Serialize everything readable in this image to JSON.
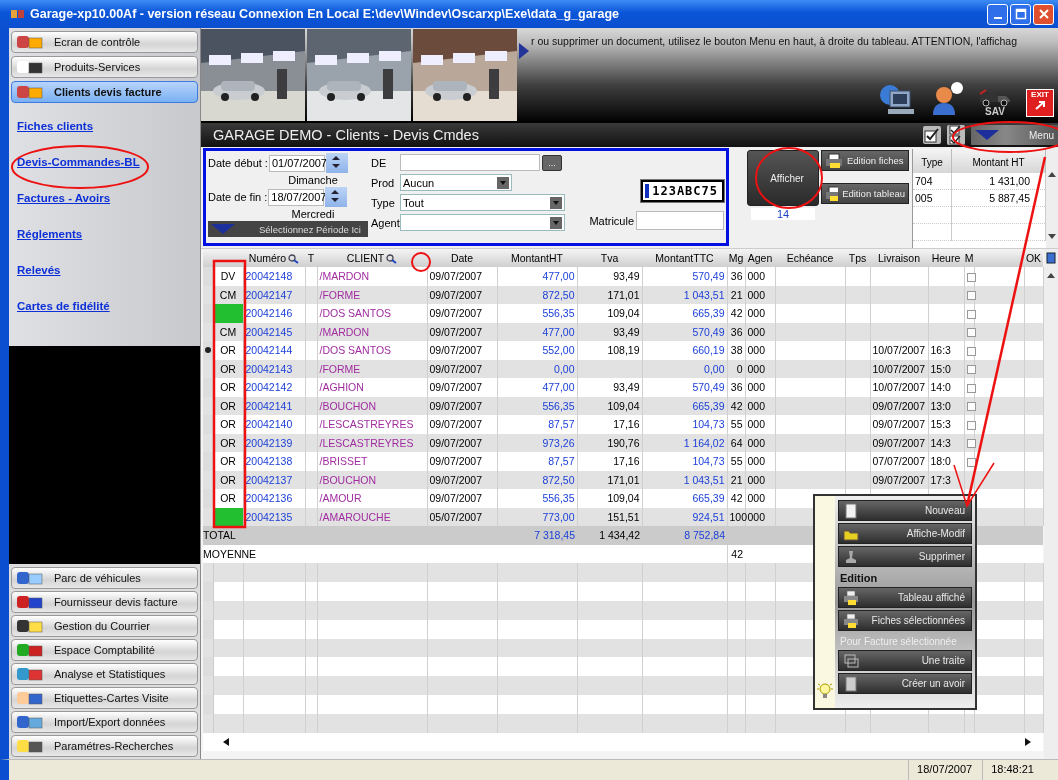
{
  "window": {
    "title": "Garage-xp10.00Af - version réseau Connexion En Local E:\\dev\\Windev\\Oscarxp\\Exe\\data_g_garage"
  },
  "sidebar": {
    "top_modules": [
      {
        "label": "Ecran de contrôle",
        "selected": false
      },
      {
        "label": "Produits-Services",
        "selected": false
      },
      {
        "label": "Clients devis facture",
        "selected": true
      }
    ],
    "links": [
      "Fiches clients",
      "Devis-Commandes-BL",
      "Factures - Avoirs",
      "Réglements",
      "Relevés",
      "Cartes de fidélité"
    ],
    "bottom_modules": [
      {
        "label": "Parc de véhicules",
        "selected": false
      },
      {
        "label": "Fournisseur devis facture",
        "selected": false
      },
      {
        "label": "Gestion du Courrier",
        "selected": false
      },
      {
        "label": "Espace Comptabilité",
        "selected": false
      },
      {
        "label": "Analyse et Statistiques",
        "selected": false
      },
      {
        "label": "Etiquettes-Cartes Visite",
        "selected": false
      },
      {
        "label": "Import/Export données",
        "selected": false
      },
      {
        "label": "Paramétres-Recherches",
        "selected": false
      }
    ]
  },
  "banner": {
    "ticker": "r ou supprimer un document, utilisez le bouton Menu en haut, à droite du tableau.  ATTENTION, l'affichag",
    "sav_label": "SAV",
    "exit_label": "EXIT"
  },
  "panel": {
    "title": "GARAGE DEMO - Clients - Devis Cmdes",
    "menu_button": "Menu"
  },
  "filters": {
    "start_label": "Date début :",
    "start_date": "01/07/2007",
    "start_day": "Dimanche",
    "end_label": "Date de fin :",
    "end_date": "18/07/2007",
    "end_day": "Mercredi",
    "period_button": "Sélectionnez Période Ici",
    "de_label": "DE",
    "de_button": "...",
    "prod_label": "Prod",
    "prod_value": "Aucun",
    "type_label": "Type",
    "type_value": "Tout",
    "agent_label": "Agent",
    "plate": "123ABC75",
    "matricule_label": "Matricule"
  },
  "actions": {
    "show_button": "Afficher",
    "count": "14",
    "edit_cards_button": "Edition fiches",
    "edit_table_button": "Edition tableau"
  },
  "summary": {
    "columns": [
      "Type",
      "Montant HT"
    ],
    "rows": [
      [
        "704",
        "1 431,00"
      ],
      [
        "005",
        "5 887,45"
      ]
    ]
  },
  "table": {
    "columns": [
      "",
      "",
      "Numéro",
      "T",
      "CLIENT",
      "Date",
      "MontantHT",
      "Tva",
      "MontantTTC",
      "Mg",
      "Agen",
      "Echéance",
      "Tps",
      "Livraison",
      "Heure",
      "M",
      "",
      "OK"
    ],
    "rows": [
      {
        "code": "DV",
        "number": "20042148",
        "client": "/MARDON",
        "date": "09/07/2007",
        "ht": "477,00",
        "tva": "93,49",
        "ttc": "570,49",
        "mg": "36",
        "agen": "000",
        "highlighted": false,
        "selected": false,
        "checked": false
      },
      {
        "code": "CM",
        "number": "20042147",
        "client": "/FORME",
        "date": "09/07/2007",
        "ht": "872,50",
        "tva": "171,01",
        "ttc": "1 043,51",
        "mg": "21",
        "agen": "000",
        "highlighted": false,
        "selected": false,
        "checked": false
      },
      {
        "number": "20042146",
        "client": "/DOS SANTOS",
        "date": "09/07/2007",
        "ht": "556,35",
        "tva": "109,04",
        "ttc": "665,39",
        "mg": "42",
        "agen": "000",
        "highlighted": true,
        "selected": false,
        "checked": false
      },
      {
        "code": "CM",
        "number": "20042145",
        "client": "/MARDON",
        "date": "09/07/2007",
        "ht": "477,00",
        "tva": "93,49",
        "ttc": "570,49",
        "mg": "36",
        "agen": "000",
        "highlighted": false,
        "selected": false,
        "checked": false
      },
      {
        "code": "OR",
        "number": "20042144",
        "client": "/DOS SANTOS",
        "date": "09/07/2007",
        "ht": "552,00",
        "tva": "108,19",
        "ttc": "660,19",
        "mg": "38",
        "agen": "000",
        "delivery": "10/07/2007",
        "hour": "16:3",
        "highlighted": false,
        "selected": true,
        "checked": false
      },
      {
        "code": "OR",
        "number": "20042143",
        "client": "/FORME",
        "date": "09/07/2007",
        "ht": "0,00",
        "ttc": "0,00",
        "mg": "0",
        "agen": "000",
        "delivery": "10/07/2007",
        "hour": "15:0",
        "highlighted": false,
        "selected": false,
        "checked": false
      },
      {
        "code": "OR",
        "number": "20042142",
        "client": "/AGHION",
        "date": "09/07/2007",
        "ht": "477,00",
        "tva": "93,49",
        "ttc": "570,49",
        "mg": "36",
        "agen": "000",
        "delivery": "10/07/2007",
        "hour": "14:0",
        "highlighted": false,
        "selected": false,
        "checked": false
      },
      {
        "code": "OR",
        "number": "20042141",
        "client": "/BOUCHON",
        "date": "09/07/2007",
        "ht": "556,35",
        "tva": "109,04",
        "ttc": "665,39",
        "mg": "42",
        "agen": "000",
        "delivery": "09/07/2007",
        "hour": "13:0",
        "highlighted": false,
        "selected": false,
        "checked": false
      },
      {
        "code": "OR",
        "number": "20042140",
        "client": "/LESCASTREYRES",
        "date": "09/07/2007",
        "ht": "87,57",
        "tva": "17,16",
        "ttc": "104,73",
        "mg": "55",
        "agen": "000",
        "delivery": "09/07/2007",
        "hour": "15:3",
        "highlighted": false,
        "selected": false,
        "checked": false
      },
      {
        "code": "OR",
        "number": "20042139",
        "client": "/LESCASTREYRES",
        "date": "09/07/2007",
        "ht": "973,26",
        "tva": "190,76",
        "ttc": "1 164,02",
        "mg": "64",
        "agen": "000",
        "delivery": "09/07/2007",
        "hour": "14:3",
        "highlighted": false,
        "selected": false,
        "checked": false
      },
      {
        "code": "OR",
        "number": "20042138",
        "client": "/BRISSET",
        "date": "09/07/2007",
        "ht": "87,57",
        "tva": "17,16",
        "ttc": "104,73",
        "mg": "55",
        "agen": "000",
        "delivery": "07/07/2007",
        "hour": "18:0",
        "highlighted": false,
        "selected": false,
        "checked": false
      },
      {
        "code": "OR",
        "number": "20042137",
        "client": "/BOUCHON",
        "date": "09/07/2007",
        "ht": "872,50",
        "tva": "171,01",
        "ttc": "1 043,51",
        "mg": "21",
        "agen": "000",
        "delivery": "09/07/2007",
        "hour": "17:3",
        "highlighted": false,
        "selected": false
      },
      {
        "code": "OR",
        "number": "20042136",
        "client": "/AMOUR",
        "date": "09/07/2007",
        "ht": "556,35",
        "tva": "109,04",
        "ttc": "665,39",
        "mg": "42",
        "agen": "000",
        "highlighted": false,
        "selected": false
      },
      {
        "number": "20042135",
        "client": "/AMAROUCHE",
        "date": "05/07/2007",
        "ht": "773,00",
        "tva": "151,51",
        "ttc": "924,51",
        "mg": "100",
        "agen": "000",
        "highlighted": true,
        "selected": false
      }
    ],
    "total": {
      "label": "TOTAL",
      "ht": "7 318,45",
      "tva": "1 434,42",
      "ttc": "8 752,84"
    },
    "average": {
      "label": "MOYENNE",
      "mg": "42"
    }
  },
  "popup_menu": [
    {
      "kind": "button",
      "label": "Nouveau",
      "disabled": false
    },
    {
      "kind": "button",
      "label": "Affiche-Modif",
      "disabled": false
    },
    {
      "kind": "button",
      "label": "Supprimer",
      "disabled": false
    },
    {
      "kind": "heading",
      "label": "Edition",
      "disabled": false
    },
    {
      "kind": "button",
      "label": "Tableau affiché",
      "disabled": false
    },
    {
      "kind": "button",
      "label": "Fiches sélectionnées",
      "disabled": false
    },
    {
      "kind": "heading",
      "label": "Pour Facture sélectionnée",
      "disabled": true
    },
    {
      "kind": "button",
      "label": "Une traite",
      "disabled": false
    },
    {
      "kind": "button",
      "label": "Créer un avoir",
      "disabled": false
    }
  ],
  "status_bar": {
    "date": "18/07/2007",
    "time": "18:48:21"
  }
}
